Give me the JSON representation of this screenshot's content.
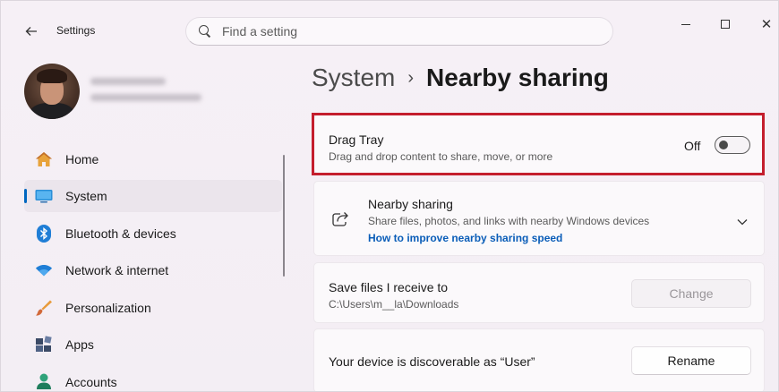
{
  "window": {
    "title": "Settings"
  },
  "search": {
    "placeholder": "Find a setting"
  },
  "nav": {
    "items": [
      {
        "label": "Home",
        "icon": "home-icon"
      },
      {
        "label": "System",
        "icon": "system-icon",
        "selected": true
      },
      {
        "label": "Bluetooth & devices",
        "icon": "bluetooth-icon"
      },
      {
        "label": "Network & internet",
        "icon": "wifi-icon"
      },
      {
        "label": "Personalization",
        "icon": "brush-icon"
      },
      {
        "label": "Apps",
        "icon": "apps-icon"
      },
      {
        "label": "Accounts",
        "icon": "person-icon"
      }
    ]
  },
  "breadcrumb": {
    "parent": "System",
    "separator": "›",
    "current": "Nearby sharing"
  },
  "drag_tray": {
    "title": "Drag Tray",
    "subtitle": "Drag and drop content to share, move, or more",
    "state_label": "Off",
    "enabled": false,
    "highlight_color": "#c41e2d"
  },
  "nearby_sharing": {
    "title": "Nearby sharing",
    "subtitle": "Share files, photos, and links with nearby Windows devices",
    "link": "How to improve nearby sharing speed"
  },
  "save_files": {
    "title": "Save files I receive to",
    "path": "C:\\Users\\m__la\\Downloads",
    "button": "Change"
  },
  "discoverable": {
    "title": "Your device is discoverable as “User”",
    "button": "Rename"
  },
  "colors": {
    "accent": "#0067c0",
    "link": "#0a5db8"
  }
}
